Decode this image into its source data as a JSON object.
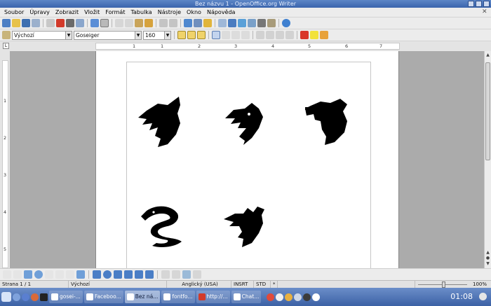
{
  "window": {
    "title": "Bez názvu 1 - OpenOffice.org Writer"
  },
  "menu": [
    "Soubor",
    "Úpravy",
    "Zobrazit",
    "Vložit",
    "Formát",
    "Tabulka",
    "Nástroje",
    "Okno",
    "Nápověda"
  ],
  "format_bar": {
    "style": "Výchozí",
    "font": "Goseiger",
    "size": "160"
  },
  "ruler": {
    "h_numbers": [
      "1",
      "1",
      "2",
      "3",
      "4",
      "5",
      "6",
      "7"
    ],
    "v_numbers": [
      "1",
      "2",
      "3",
      "4",
      "5"
    ]
  },
  "statusbar": {
    "page": "Strana 1 / 1",
    "style": "Výchozí",
    "language": "Anglický (USA)",
    "insert_mode": "INSRT",
    "selection_mode": "STD",
    "zoom": "100%"
  },
  "taskbar": {
    "tasks": [
      "gosei-...",
      "Faceboo...",
      "Bez ná...",
      "fontfo...",
      "http://...",
      "Chat..."
    ],
    "clock": "01:08"
  },
  "glyphs": [
    "dragon-head-1",
    "dragon-head-2",
    "dragon-head-3",
    "serpent",
    "dragon-head-5"
  ],
  "colors": {
    "titlebar": "#3a64ad",
    "taskbar": "#4a6fb3",
    "glyph": "#000000"
  }
}
